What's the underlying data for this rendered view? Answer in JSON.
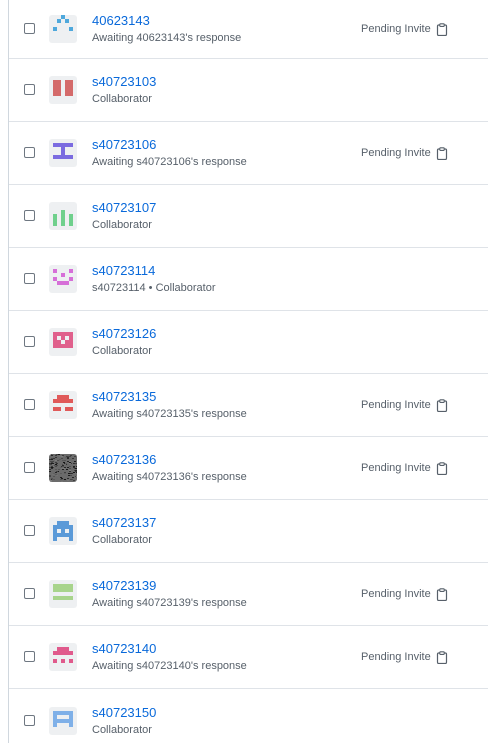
{
  "status_label": "Pending Invite",
  "members": [
    {
      "name": "40623143",
      "subtitle": "Awaiting 40623143's response",
      "pending": true,
      "avatar_color": "#4ea8dc",
      "avatar_pattern": "dots"
    },
    {
      "name": "s40723103",
      "subtitle": "Collaborator",
      "pending": false,
      "avatar_color": "#d46a6a",
      "avatar_pattern": "bars"
    },
    {
      "name": "s40723106",
      "subtitle": "Awaiting s40723106's response",
      "pending": true,
      "avatar_color": "#7b6be0",
      "avatar_pattern": "tee"
    },
    {
      "name": "s40723107",
      "subtitle": "Collaborator",
      "pending": false,
      "avatar_color": "#6fd08c",
      "avatar_pattern": "columns"
    },
    {
      "name": "s40723114",
      "subtitle": "s40723114 • Collaborator",
      "pending": false,
      "avatar_color": "#d66fd8",
      "avatar_pattern": "face"
    },
    {
      "name": "s40723126",
      "subtitle": "Collaborator",
      "pending": false,
      "avatar_color": "#e0608c",
      "avatar_pattern": "box"
    },
    {
      "name": "s40723135",
      "subtitle": "Awaiting s40723135's response",
      "pending": true,
      "avatar_color": "#e05a5a",
      "avatar_pattern": "arch"
    },
    {
      "name": "s40723136",
      "subtitle": "Awaiting s40723136's response",
      "pending": true,
      "avatar_color": "#3a3a3a",
      "avatar_pattern": "noise"
    },
    {
      "name": "s40723137",
      "subtitle": "Collaborator",
      "pending": false,
      "avatar_color": "#5b9ad8",
      "avatar_pattern": "invader"
    },
    {
      "name": "s40723139",
      "subtitle": "Awaiting s40723139's response",
      "pending": true,
      "avatar_color": "#a8d48c",
      "avatar_pattern": "block"
    },
    {
      "name": "s40723140",
      "subtitle": "Awaiting s40723140's response",
      "pending": true,
      "avatar_color": "#e05a8c",
      "avatar_pattern": "arch2"
    },
    {
      "name": "s40723150",
      "subtitle": "Collaborator",
      "pending": false,
      "avatar_color": "#7fb0e8",
      "avatar_pattern": "robot"
    }
  ]
}
